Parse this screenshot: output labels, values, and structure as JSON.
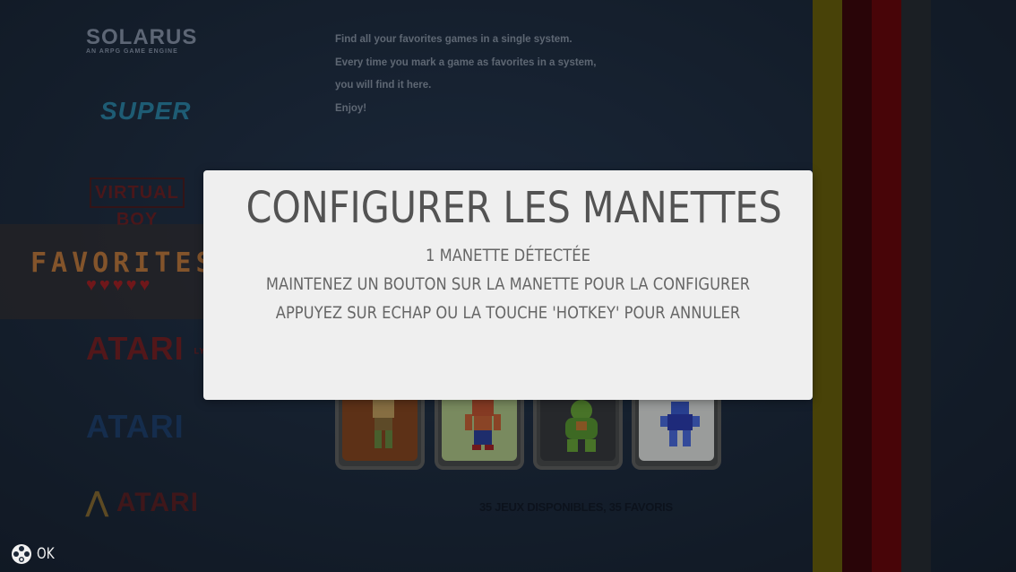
{
  "systems": {
    "solarus": {
      "name": "SOLARUS",
      "tagline": "AN ARPG GAME ENGINE"
    },
    "supergrafx": {
      "name": "SUPER"
    },
    "virtualboy": {
      "name": "VIRTUAL BOY"
    },
    "favorites": {
      "name": "FAVORITES",
      "hearts": [
        "♥",
        "♥",
        "♥",
        "♥",
        "♥"
      ]
    },
    "atari_lynx": {
      "name": "ATARI",
      "suffix": "LYNX"
    },
    "atari_st": {
      "name": "ATARI"
    },
    "atari_2600": {
      "name": "ATARI"
    }
  },
  "description": {
    "lines": [
      "Find all your favorites games in a single system.",
      "Every time you mark a game as favorites in a system,",
      "you will find it here.",
      "Enjoy!"
    ]
  },
  "games_count": "35 JEUX DISPONIBLES, 35 FAVORIS",
  "modal": {
    "title": "CONFIGURER LES MANETTES",
    "detected": "1 MANETTE DÉTECTÉE",
    "instruction": "MAINTENEZ UN BOUTON SUR LA MANETTE POUR LA CONFIGURER",
    "cancel_hint": "APPUYEZ SUR ECHAP OU LA TOUCHE 'HOTKEY' POUR ANNULER"
  },
  "help": {
    "icon": "gamepad-buttons-icon",
    "label": "OK"
  },
  "colors": {
    "stripe_1": "#6b5e00",
    "stripe_2": "#3b0000",
    "stripe_3": "#6b0000",
    "stripe_4": "#26292c",
    "modal_bg": "#efefef",
    "modal_text": "#535353"
  }
}
